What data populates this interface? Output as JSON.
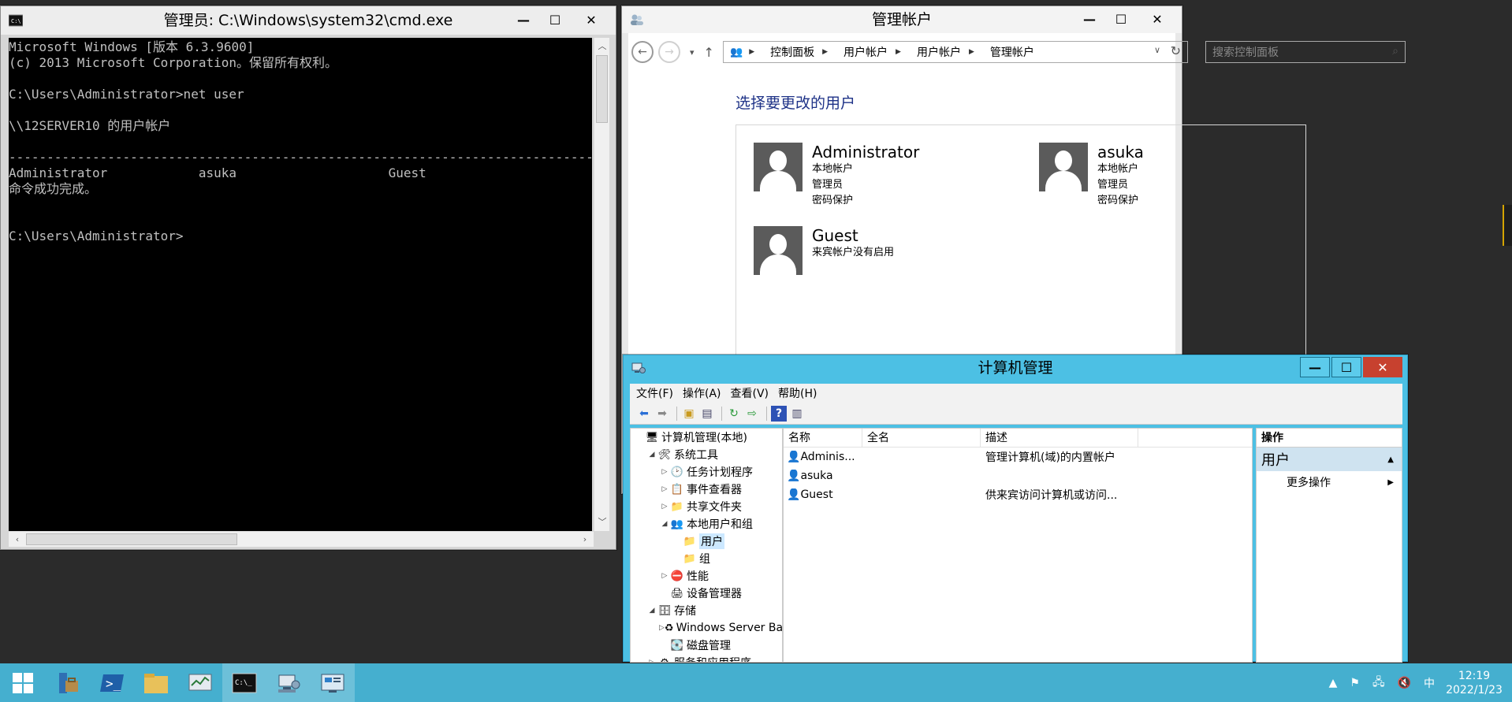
{
  "cmd": {
    "title": "管理员: C:\\Windows\\system32\\cmd.exe",
    "lines": [
      "Microsoft Windows [版本 6.3.9600]",
      "(c) 2013 Microsoft Corporation。保留所有权利。",
      "",
      "C:\\Users\\Administrator>net user",
      "",
      "\\\\12SERVER10 的用户帐户",
      "",
      "-------------------------------------------------------------------------------",
      "Administrator            asuka                    Guest",
      "命令成功完成。",
      "",
      "",
      "C:\\Users\\Administrator>"
    ]
  },
  "control_panel": {
    "title": "管理帐户",
    "breadcrumbs": [
      "控制面板",
      "用户帐户",
      "用户帐户",
      "管理帐户"
    ],
    "search_placeholder": "搜索控制面板",
    "heading": "选择要更改的用户",
    "accounts": [
      {
        "name": "Administrator",
        "details": [
          "本地帐户",
          "管理员",
          "密码保护"
        ]
      },
      {
        "name": "asuka",
        "details": [
          "本地帐户",
          "管理员",
          "密码保护"
        ]
      },
      {
        "name": "Guest",
        "details": [
          "来宾帐户没有启用"
        ]
      }
    ]
  },
  "computer_management": {
    "title": "计算机管理",
    "menu": [
      "文件(F)",
      "操作(A)",
      "查看(V)",
      "帮助(H)"
    ],
    "tree": [
      {
        "label": "计算机管理(本地)",
        "level": 0,
        "twisty": "",
        "icon": "computer-mgmt-icon"
      },
      {
        "label": "系统工具",
        "level": 1,
        "twisty": "◢",
        "icon": "tools-icon"
      },
      {
        "label": "任务计划程序",
        "level": 2,
        "twisty": "▷",
        "icon": "clock-icon"
      },
      {
        "label": "事件查看器",
        "level": 2,
        "twisty": "▷",
        "icon": "event-viewer-icon"
      },
      {
        "label": "共享文件夹",
        "level": 2,
        "twisty": "▷",
        "icon": "shared-folder-icon"
      },
      {
        "label": "本地用户和组",
        "level": 2,
        "twisty": "◢",
        "icon": "users-groups-icon"
      },
      {
        "label": "用户",
        "level": 3,
        "twisty": "",
        "icon": "folder-icon",
        "selected": true
      },
      {
        "label": "组",
        "level": 3,
        "twisty": "",
        "icon": "folder-icon"
      },
      {
        "label": "性能",
        "level": 2,
        "twisty": "▷",
        "icon": "performance-icon"
      },
      {
        "label": "设备管理器",
        "level": 2,
        "twisty": "",
        "icon": "device-manager-icon"
      },
      {
        "label": "存储",
        "level": 1,
        "twisty": "◢",
        "icon": "storage-icon"
      },
      {
        "label": "Windows Server Backup",
        "level": 2,
        "twisty": "▷",
        "icon": "backup-icon"
      },
      {
        "label": "磁盘管理",
        "level": 2,
        "twisty": "",
        "icon": "disk-icon"
      },
      {
        "label": "服务和应用程序",
        "level": 1,
        "twisty": "▷",
        "icon": "services-icon"
      }
    ],
    "columns": [
      "名称",
      "全名",
      "描述"
    ],
    "rows": [
      {
        "name": "Adminis...",
        "fullname": "",
        "description": "管理计算机(域)的内置帐户"
      },
      {
        "name": "asuka",
        "fullname": "",
        "description": ""
      },
      {
        "name": "Guest",
        "fullname": "",
        "description": "供来宾访问计算机或访问..."
      }
    ],
    "actions_header": "操作",
    "actions_section": "用户",
    "actions_items": [
      "更多操作"
    ]
  },
  "taskbar": {
    "time": "12:19",
    "date": "2022/1/23",
    "ime": "中"
  }
}
